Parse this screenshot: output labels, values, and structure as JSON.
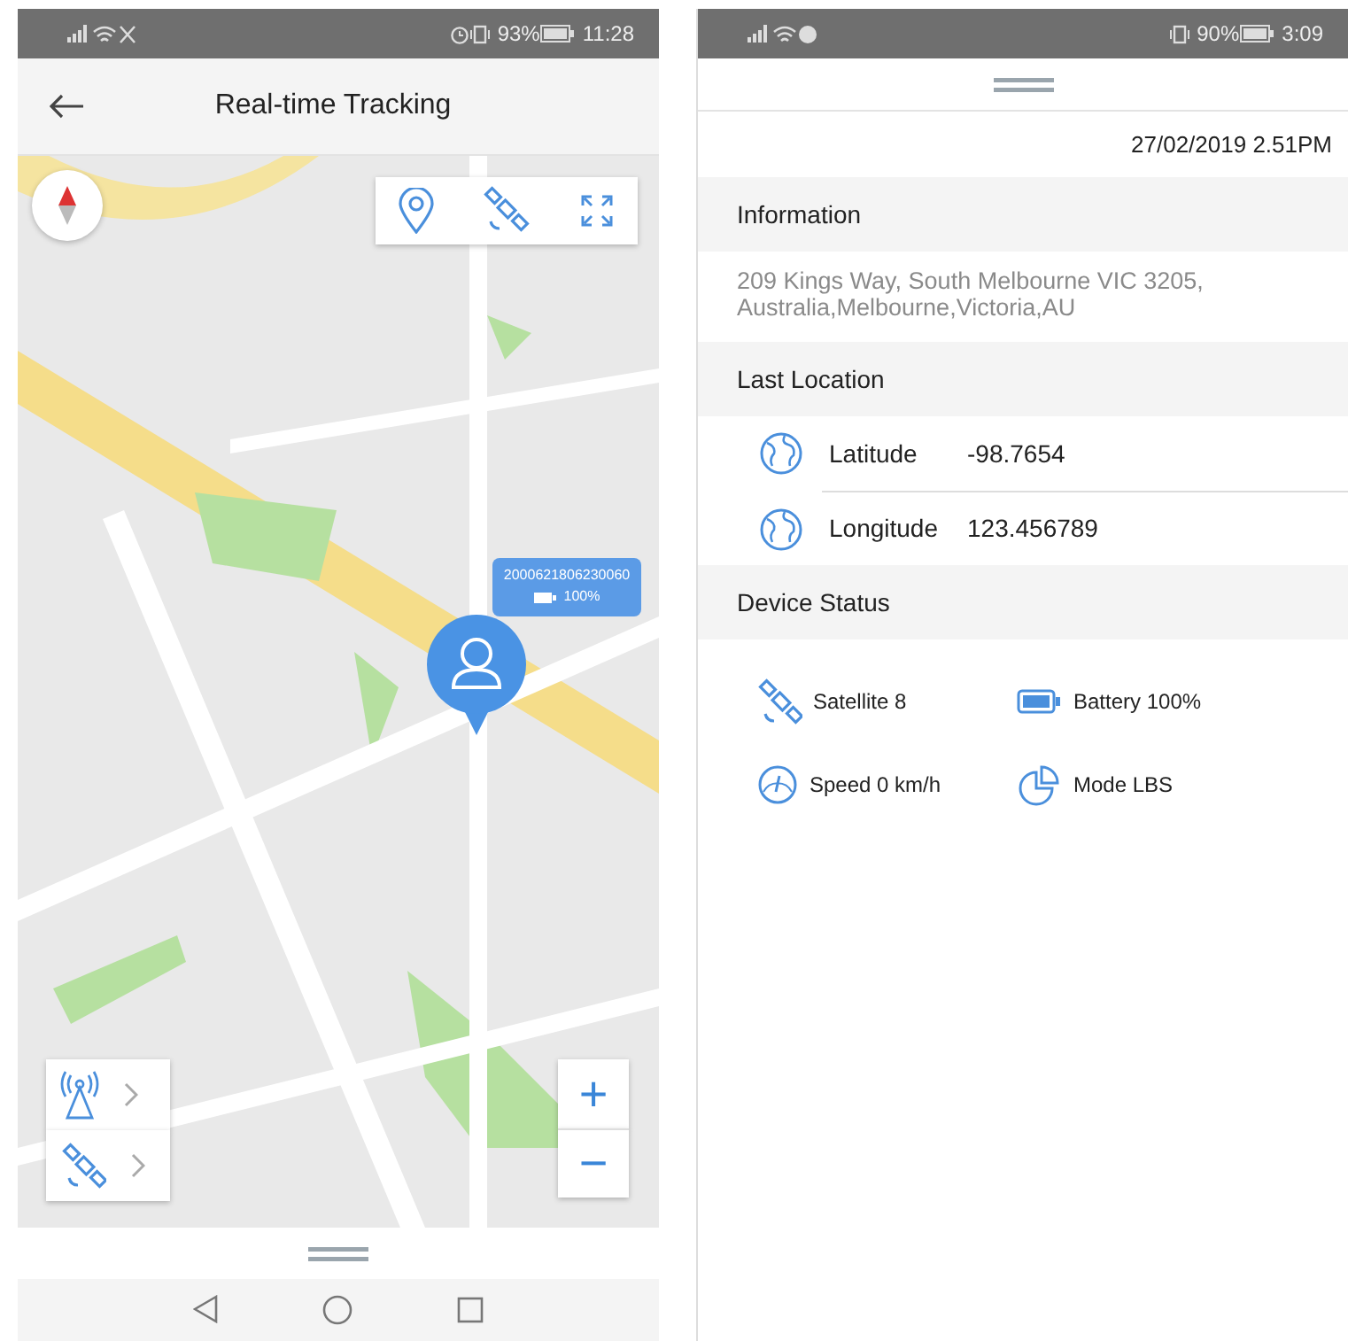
{
  "tracking_screen": {
    "status_bar": {
      "battery": "93%",
      "time": "11:28"
    },
    "title": "Real-time Tracking",
    "map": {
      "kind": "picture",
      "device_label": {
        "id": "2000621806230060",
        "battery": "100%"
      },
      "zoom_in": "+",
      "zoom_out": "−"
    }
  },
  "details_screen": {
    "status_bar": {
      "battery": "90%",
      "time": "3:09"
    },
    "timestamp": "27/02/2019 2.51PM",
    "sections": [
      {
        "kind": "text",
        "title": "Information",
        "text": "209 Kings Way, South Melbourne VIC 3205, Australia,Melbourne,Victoria,AU"
      },
      {
        "kind": "coords",
        "title": "Last Location",
        "rows": [
          {
            "label": "Latitude",
            "value": "-98.7654"
          },
          {
            "label": "Longitude",
            "value": "123.456789"
          }
        ]
      },
      {
        "kind": "status",
        "title": "Device Status",
        "items": [
          {
            "kind": "satellite",
            "text": "Satellite 8"
          },
          {
            "kind": "battery",
            "text": "Battery 100%"
          },
          {
            "kind": "speed",
            "text": "Speed 0 km/h"
          },
          {
            "kind": "mode",
            "text": "Mode LBS"
          }
        ]
      }
    ]
  }
}
